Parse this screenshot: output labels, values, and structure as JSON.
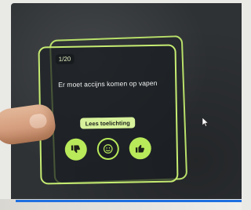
{
  "card": {
    "progress": "1/20",
    "statement": "Er moet accijns komen op vapen",
    "explain_button": "Lees toelichting"
  },
  "actions": {
    "disagree_icon": "thumbs-down-icon",
    "neutral_icon": "neutral-face-icon",
    "agree_icon": "thumbs-up-icon"
  },
  "colors": {
    "accent": "#c6ec72",
    "card_bg": "#1c2024",
    "button_bg": "#d7f29b"
  }
}
